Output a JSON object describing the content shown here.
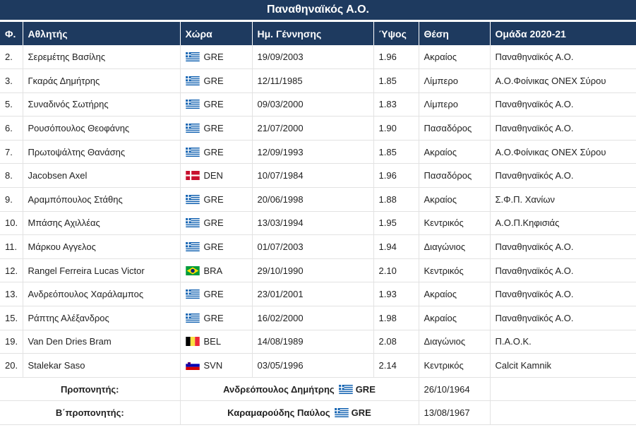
{
  "page": {
    "title": "Παναθηναϊκός Α.Ο."
  },
  "table": {
    "headers": [
      "Φ.",
      "Αθλητής",
      "Χώρα",
      "Ημ. Γέννησης",
      "Ύψος",
      "Θέση",
      "Ομάδα 2020-21"
    ],
    "rows": [
      {
        "num": "2.",
        "name": "Σερεμέτης Βασίλης",
        "flag": "gre",
        "country": "GRE",
        "dob": "19/09/2003",
        "height": "1.96",
        "position": "Ακραίος",
        "team": "Παναθηναϊκός Α.Ο."
      },
      {
        "num": "3.",
        "name": "Γκαράς Δημήτρης",
        "flag": "gre",
        "country": "GRE",
        "dob": "12/11/1985",
        "height": "1.85",
        "position": "Λίμπερο",
        "team": "Α.Ο.Φοίνικας ΟΝΕΧ Σύρου"
      },
      {
        "num": "5.",
        "name": "Συναδινός Σωτήρης",
        "flag": "gre",
        "country": "GRE",
        "dob": "09/03/2000",
        "height": "1.83",
        "position": "Λίμπερο",
        "team": "Παναθηναϊκός Α.Ο."
      },
      {
        "num": "6.",
        "name": "Ρουσόπουλος Θεοφάνης",
        "flag": "gre",
        "country": "GRE",
        "dob": "21/07/2000",
        "height": "1.90",
        "position": "Πασαδόρος",
        "team": "Παναθηναϊκός Α.Ο."
      },
      {
        "num": "7.",
        "name": "Πρωτοψάλτης Θανάσης",
        "flag": "gre",
        "country": "GRE",
        "dob": "12/09/1993",
        "height": "1.85",
        "position": "Ακραίος",
        "team": "Α.Ο.Φοίνικας ΟΝΕΧ Σύρου"
      },
      {
        "num": "8.",
        "name": "Jacobsen Axel",
        "flag": "den",
        "country": "DEN",
        "dob": "10/07/1984",
        "height": "1.96",
        "position": "Πασαδόρος",
        "team": "Παναθηναϊκός Α.Ο."
      },
      {
        "num": "9.",
        "name": "Αραμπόπουλος Στάθης",
        "flag": "gre",
        "country": "GRE",
        "dob": "20/06/1998",
        "height": "1.88",
        "position": "Ακραίος",
        "team": "Σ.Φ.Π. Χανίων"
      },
      {
        "num": "10.",
        "name": "Μπάσης Αχιλλέας",
        "flag": "gre",
        "country": "GRE",
        "dob": "13/03/1994",
        "height": "1.95",
        "position": "Κεντρικός",
        "team": "Α.Ο.Π.Κηφισιάς"
      },
      {
        "num": "11.",
        "name": "Μάρκου Αγγελος",
        "flag": "gre",
        "country": "GRE",
        "dob": "01/07/2003",
        "height": "1.94",
        "position": "Διαγώνιος",
        "team": "Παναθηναϊκός Α.Ο."
      },
      {
        "num": "12.",
        "name": "Rangel Ferreira Lucas Victor",
        "flag": "bra",
        "country": "BRA",
        "dob": "29/10/1990",
        "height": "2.10",
        "position": "Κεντρικός",
        "team": "Παναθηναϊκός Α.Ο."
      },
      {
        "num": "13.",
        "name": "Ανδρεόπουλος Χαράλαμπος",
        "flag": "gre",
        "country": "GRE",
        "dob": "23/01/2001",
        "height": "1.93",
        "position": "Ακραίος",
        "team": "Παναθηναϊκός Α.Ο."
      },
      {
        "num": "15.",
        "name": "Ράπτης Αλέξανδρος",
        "flag": "gre",
        "country": "GRE",
        "dob": "16/02/2000",
        "height": "1.98",
        "position": "Ακραίος",
        "team": "Παναθηναϊκός Α.Ο."
      },
      {
        "num": "19.",
        "name": "Van Den Dries Bram",
        "flag": "bel",
        "country": "BEL",
        "dob": "14/08/1989",
        "height": "2.08",
        "position": "Διαγώνιος",
        "team": "Π.Α.Ο.Κ."
      },
      {
        "num": "20.",
        "name": "Stalekar Saso",
        "flag": "svn",
        "country": "SVN",
        "dob": "03/05/1996",
        "height": "2.14",
        "position": "Κεντρικός",
        "team": "Calcit Kamnik"
      }
    ]
  },
  "coaches": [
    {
      "label": "Προπονητής:",
      "name": "Ανδρεόπουλος Δημήτρης",
      "flag": "gre",
      "country": "GRE",
      "dob": "26/10/1964"
    },
    {
      "label": "Β΄προπονητής:",
      "name": "Καραμαρούδης Παύλος",
      "flag": "gre",
      "country": "GRE",
      "dob": "13/08/1967"
    }
  ],
  "flag_colors": {
    "gre": {
      "blue": "#0d5eaf",
      "white": "#ffffff"
    },
    "den": {
      "red": "#c8102e",
      "white": "#ffffff"
    },
    "bra": {
      "green": "#009c3b",
      "yellow": "#ffdf00",
      "blue": "#002776"
    },
    "bel": {
      "black": "#000000",
      "yellow": "#fae042",
      "red": "#ed2939"
    },
    "svn": {
      "white": "#ffffff",
      "blue": "#0000b4",
      "red": "#d50000"
    }
  },
  "theme": {
    "header_bg": "#1e3a5f",
    "header_text": "#ffffff",
    "row_border": "#e2e2e2"
  }
}
